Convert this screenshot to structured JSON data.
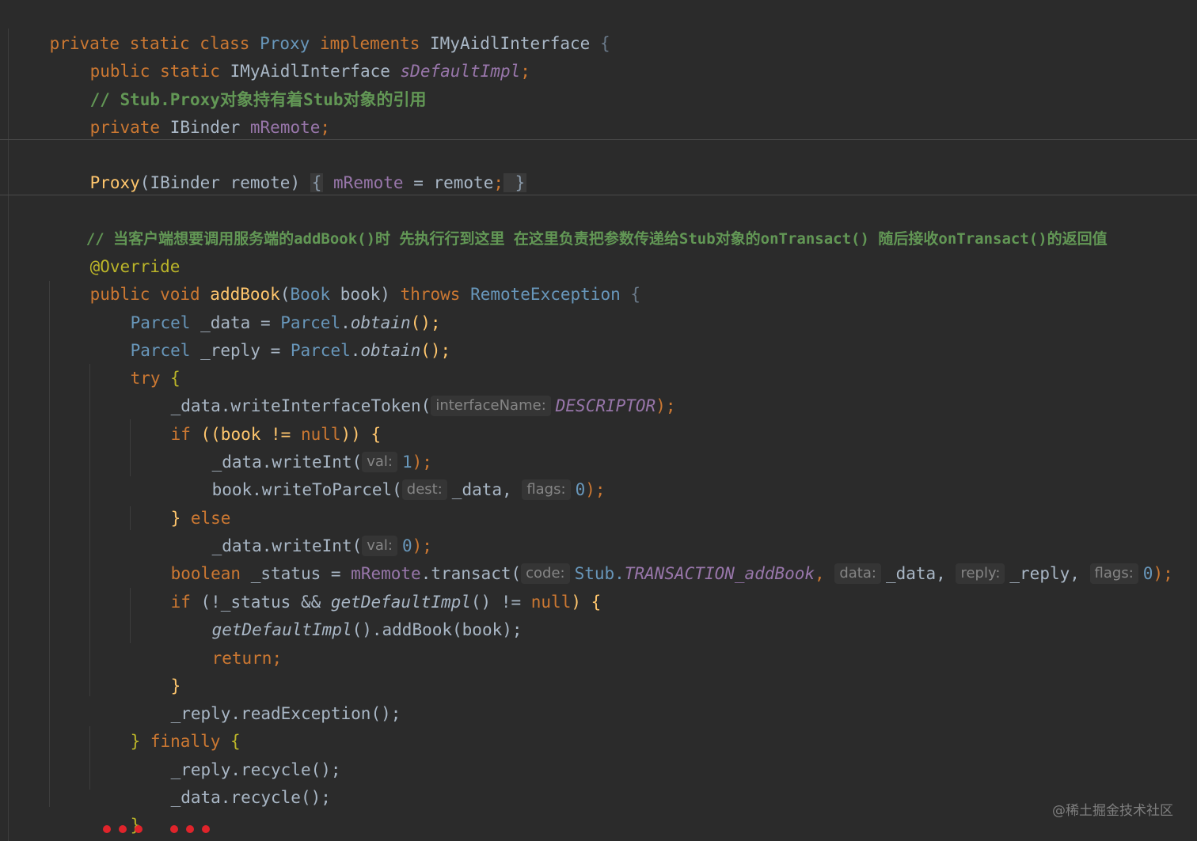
{
  "code": {
    "l1": {
      "a": "private static class ",
      "b": "Proxy",
      "c": " implements ",
      "d": "IMyAidlInterface",
      "e": " {"
    },
    "l2": {
      "a": "public static ",
      "b": "IMyAidlInterface ",
      "c": "sDefaultImpl",
      "d": ";"
    },
    "l3": {
      "a": "// Stub.Proxy对象持有着Stub对象的引用"
    },
    "l4": {
      "a": "private ",
      "b": "IBinder ",
      "c": "mRemote",
      "d": ";"
    },
    "l5": {
      "a": "Proxy",
      "b": "(IBinder remote) ",
      "c": "{",
      "d": " mRemote",
      "e": " = remote",
      "f": ";",
      "g": " }"
    },
    "l6": {
      "a": "// 当客户端想要调用服务端的addBook()时 先执行行到这里 在这里负责把参数传递给Stub对象的onTransact() 随后接收onTransact()的返回值"
    },
    "l7": {
      "a": "@Override"
    },
    "l8": {
      "a": "public void ",
      "b": "addBook",
      "c": "(",
      "d": "Book",
      "e": " book) ",
      "f": "throws ",
      "g": "RemoteException",
      "h": " {"
    },
    "l9": {
      "a": "Parcel",
      "b": " _data = ",
      "c": "Parcel",
      "d": ".",
      "e": "obtain",
      "f": "();"
    },
    "l10": {
      "a": "Parcel",
      "b": " _reply = ",
      "c": "Parcel",
      "d": ".",
      "e": "obtain",
      "f": "();"
    },
    "l11": {
      "a": "try",
      "b": " {"
    },
    "l12": {
      "a": "_data.writeInterfaceToken(",
      "hint": "interfaceName:",
      "b": "DESCRIPTOR",
      "c": ");"
    },
    "l13": {
      "a": "if ",
      "b": "((book != ",
      "c": "null",
      "d": ")) {"
    },
    "l14": {
      "a": "_data.writeInt(",
      "hint": "val:",
      "b": "1",
      "c": ");"
    },
    "l15": {
      "a": "book.writeToParcel(",
      "hint1": "dest:",
      "b": "_data, ",
      "hint2": "flags:",
      "c": "0",
      "d": ");"
    },
    "l16": {
      "a": "} ",
      "b": "else"
    },
    "l17": {
      "a": "_data.writeInt(",
      "hint": "val:",
      "b": "0",
      "c": ");"
    },
    "l18": {
      "a": "boolean ",
      "b": "_status = ",
      "c": "mRemote",
      "d": ".transact(",
      "hint1": "code:",
      "e": "Stub.",
      "f": "TRANSACTION_addBook",
      "g": ", ",
      "hint2": "data:",
      "h": "_data, ",
      "hint3": "reply:",
      "i": "_reply, ",
      "hint4": "flags:",
      "j": "0",
      "k": ");"
    },
    "l19": {
      "a": "if ",
      "b": "(!_status && ",
      "c": "getDefaultImpl",
      "d": "() != ",
      "e": "null",
      "f": ") {"
    },
    "l20": {
      "a": "getDefaultImpl",
      "b": "().addBook(book);"
    },
    "l21": {
      "a": "return",
      "b": ";"
    },
    "l22": {
      "a": "}"
    },
    "l23": {
      "a": "_reply.readException();"
    },
    "l24": {
      "a": "} ",
      "b": "finally",
      "c": " {"
    },
    "l25": {
      "a": "_reply.recycle();"
    },
    "l26": {
      "a": "_data.recycle();"
    },
    "l27": {
      "a": "}"
    },
    "l28": {
      "a": "}"
    }
  },
  "watermark": "@稀土掘金技术社区",
  "colors": {
    "background": "#2b2b2b",
    "keyword": "#cc7832",
    "class": "#6897bb",
    "field": "#9876aa",
    "function": "#ffc66d",
    "comment": "#629755",
    "annotation": "#bbb529",
    "marker_dots": "#e0242b"
  }
}
